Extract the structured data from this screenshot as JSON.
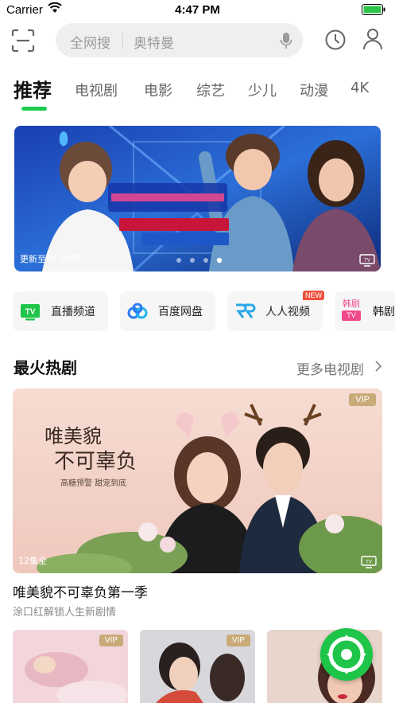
{
  "status_bar": {
    "carrier": "Carrier",
    "time": "4:47 PM"
  },
  "header": {
    "search": {
      "scope_label": "全网搜",
      "placeholder": "奥特曼"
    }
  },
  "tabs": [
    {
      "label": "推荐",
      "active": true
    },
    {
      "label": "电视剧"
    },
    {
      "label": "电影"
    },
    {
      "label": "综艺"
    },
    {
      "label": "少儿"
    },
    {
      "label": "动漫"
    },
    {
      "label": "4K"
    }
  ],
  "banner": {
    "update_text": "更新至07-28期",
    "page_count": 4,
    "active_page": 4
  },
  "quick_entries": [
    {
      "label": "直播频道",
      "icon": "tv-green-icon"
    },
    {
      "label": "百度网盘",
      "icon": "baidu-cloud-icon"
    },
    {
      "label": "人人视频",
      "icon": "renren-icon",
      "badge": "NEW"
    },
    {
      "label": "韩剧",
      "icon": "korean-drama-icon",
      "icon_text": "韩剧"
    }
  ],
  "section": {
    "title": "最火热剧",
    "more_label": "更多电视剧"
  },
  "featured": {
    "vip_badge": "VIP",
    "episodes": "12集全",
    "title": "唯美貌不可辜负第一季",
    "subtitle": "涂口红解锁人生新剧情"
  },
  "thumbnails": [
    {
      "vip_badge": "VIP"
    },
    {
      "vip_badge": "VIP"
    },
    {
      "vip_badge": ""
    }
  ],
  "colors": {
    "accent": "#1ecb50",
    "vip": "#c9ab7a",
    "badge_new": "#f0503c"
  }
}
